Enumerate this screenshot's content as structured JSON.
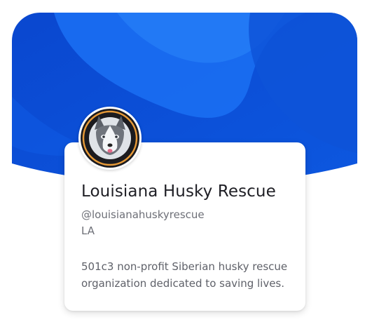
{
  "profile": {
    "name": "Louisiana Husky Rescue",
    "handle": "@louisianahuskyrescue",
    "location": "LA",
    "bio": "501c3 non-profit Siberian husky rescue organization dedicated to saving lives."
  },
  "avatar": {
    "icon": "husky-avatar-icon",
    "ring_text": "LOUISIANA HUSKY RESCUE"
  },
  "colors": {
    "banner_dark": "#0b4ed6",
    "banner_mid": "#1566f0",
    "banner_light": "#1f7cf7",
    "avatar_ring": "#e79a38",
    "name_text": "#1f1f25",
    "meta_text": "#6d6f77"
  }
}
